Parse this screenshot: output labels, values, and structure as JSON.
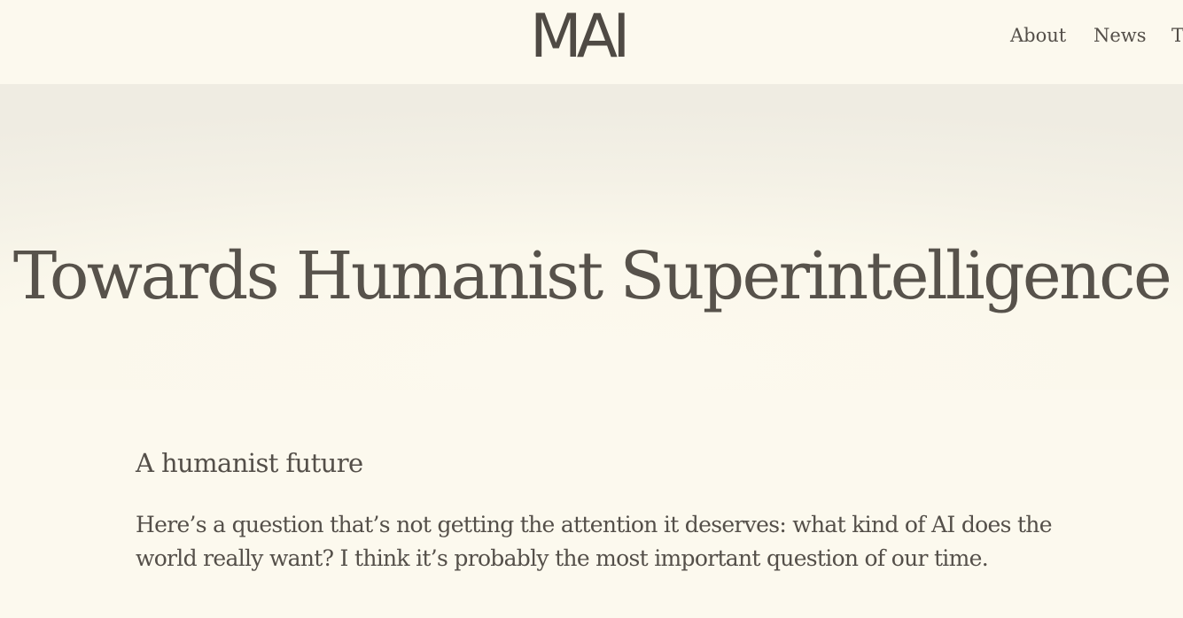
{
  "header": {
    "logo_text": "MAI",
    "nav": [
      {
        "label": "About"
      },
      {
        "label": "News"
      },
      {
        "label": "T"
      }
    ]
  },
  "hero": {
    "title": "Towards Humanist Superintelligence"
  },
  "article": {
    "heading": "A humanist future",
    "paragraph": "Here’s a question that’s not getting the attention it deserves: what kind of AI does the world really want? I think it’s probably the most important question of our time."
  },
  "colors": {
    "background": "#fcf9ee",
    "text": "#544f49",
    "hero_shade": "#efece2"
  }
}
